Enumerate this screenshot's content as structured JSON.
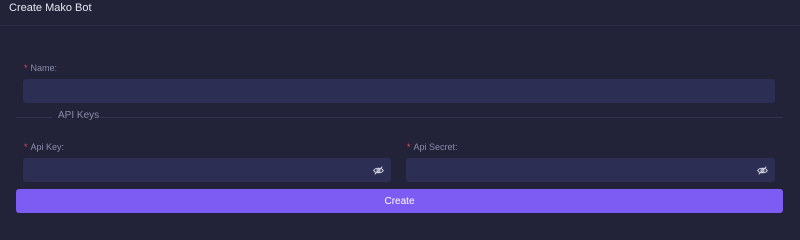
{
  "dialog": {
    "title": "Create Mako Bot"
  },
  "form": {
    "name": {
      "label": "Name:",
      "required_mark": "*",
      "value": ""
    },
    "section_title": "API Keys",
    "api_key": {
      "label": "Api Key:",
      "required_mark": "*",
      "value": ""
    },
    "api_secret": {
      "label": "Api Secret:",
      "required_mark": "*",
      "value": ""
    },
    "submit_label": "Create"
  },
  "colors": {
    "background": "#222339",
    "input_bg": "#2d2e54",
    "accent": "#7c5cf2",
    "required": "#e5484d"
  },
  "icons": {
    "visibility_toggle": "eye-slash-icon"
  }
}
